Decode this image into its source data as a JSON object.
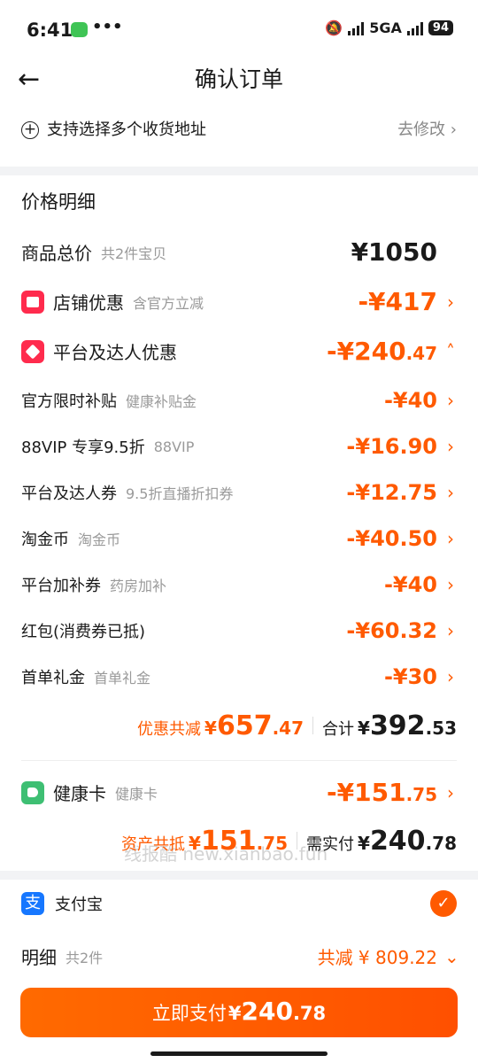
{
  "status_bar": {
    "time": "6:41",
    "dots": "•••",
    "network": "5GA",
    "battery": "94"
  },
  "header": {
    "back_icon": "←",
    "title": "确认订单"
  },
  "address": {
    "icon": "plus-circle-icon",
    "text": "支持选择多个收货地址",
    "action": "去修改"
  },
  "price_detail": {
    "title": "价格明细",
    "goods_total": {
      "label": "商品总价",
      "sub": "共2件宝贝",
      "amount": "¥1050"
    },
    "shop_discount": {
      "label": "店铺优惠",
      "sub": "含官方立减",
      "amount": "-¥417"
    },
    "platform_discount": {
      "label": "平台及达人优惠",
      "amount_main": "-¥240",
      "amount_dec": ".47"
    },
    "items": [
      {
        "label": "官方限时补贴",
        "sub": "健康补贴金",
        "amount": "-¥40"
      },
      {
        "label": "88VIP 专享9.5折",
        "sub": "88VIP",
        "amount": "-¥16.90"
      },
      {
        "label": "平台及达人券",
        "sub": "9.5折直播折扣券",
        "amount": "-¥12.75"
      },
      {
        "label": "淘金币",
        "sub": "淘金币",
        "amount": "-¥40.50"
      },
      {
        "label": "平台加补券",
        "sub": "药房加补",
        "amount": "-¥40"
      },
      {
        "label": "红包(消费券已抵)",
        "sub": "",
        "amount": "-¥60.32"
      },
      {
        "label": "首单礼金",
        "sub": "首单礼金",
        "amount": "-¥30"
      }
    ],
    "summary": {
      "discount_label": "优惠共减",
      "discount_yen": "¥",
      "discount_main": "657",
      "discount_dec": ".47",
      "total_label": "合计",
      "total_yen": "¥",
      "total_main": "392",
      "total_dec": ".53"
    },
    "health_card": {
      "label": "健康卡",
      "sub": "健康卡",
      "amount_main": "-¥151",
      "amount_dec": ".75"
    },
    "asset_summary": {
      "label": "资产共抵",
      "yen": "¥",
      "main": "151",
      "dec": ".75",
      "pay_label": "需实付",
      "pay_yen": "¥",
      "pay_main": "240",
      "pay_dec": ".78"
    },
    "watermark": "线报酷 new.xianbao.fun"
  },
  "payment": {
    "method": "支付宝",
    "alipay_icon": "支",
    "detail_label": "明细",
    "detail_sub": "共2件",
    "detail_amount": "共减 ¥ 809.22",
    "button_label": "立即支付",
    "button_yen": "¥",
    "button_main": "240",
    "button_dec": ".78"
  },
  "colors": {
    "accent": "#ff5a00",
    "shop_icon": "#ff2b4d",
    "health_icon": "#3ebf73",
    "alipay": "#1677ff"
  }
}
